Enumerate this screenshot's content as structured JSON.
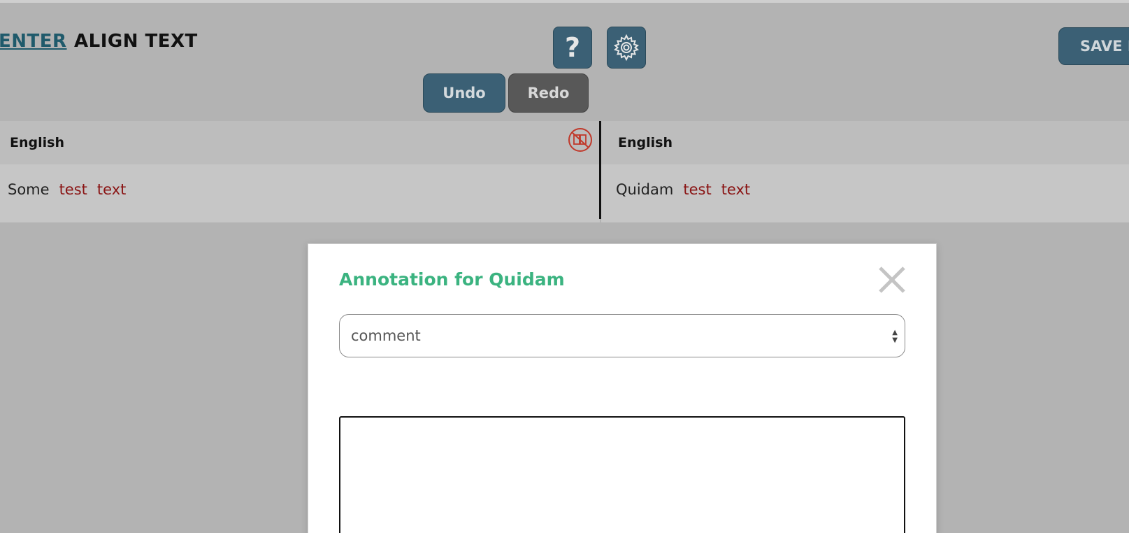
{
  "nav": {
    "prev_link": "ENTER",
    "current": "ALIGN TEXT"
  },
  "toolbar": {
    "help_label": "?",
    "save_label": "SAVE L",
    "undo_label": "Undo",
    "redo_label": "Redo"
  },
  "panes": {
    "left": {
      "language": "English",
      "words": [
        "Some",
        "test",
        "text"
      ]
    },
    "right": {
      "language": "English",
      "words": [
        "Quidam",
        "test",
        "text"
      ]
    }
  },
  "modal": {
    "title": "Annotation for Quidam",
    "select_value": "comment",
    "textarea_value": ""
  },
  "colors": {
    "accent": "#3b6075",
    "title_green": "#3bb380",
    "highlight_word": "#8a1414",
    "redo_gray": "#585858"
  }
}
